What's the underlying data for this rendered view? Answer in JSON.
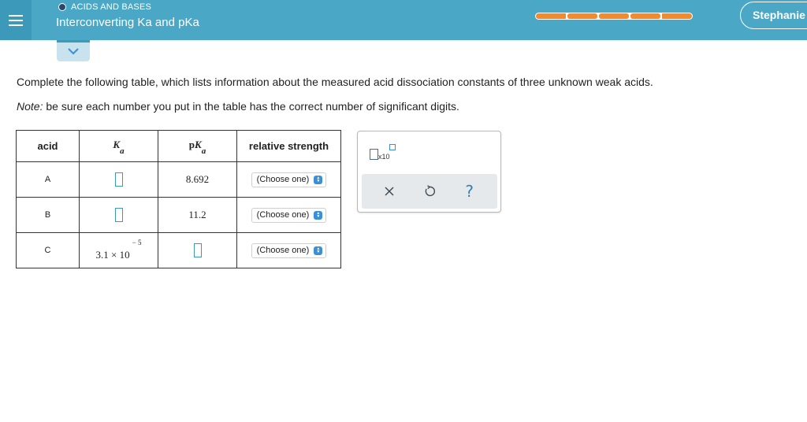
{
  "header": {
    "topic": "ACIDS AND BASES",
    "title": "Interconverting Ka and pKa",
    "user_name": "Stephanie",
    "progress_segments": 5,
    "progress_filled": 5,
    "colors": {
      "bar": "#4aa7c6",
      "progress": "#f28b2d",
      "topic_dot": "#27476e"
    }
  },
  "icons": {
    "menu": "hamburger-icon",
    "collapse": "chevron-down-icon",
    "clear": "close-icon",
    "undo": "undo-icon",
    "help": "help-icon",
    "sci_notation": "x10-icon",
    "dropdown": "select-arrows-icon"
  },
  "question": {
    "prompt": "Complete the following table, which lists information about the measured acid dissociation constants of three unknown weak acids.",
    "note_label": "Note:",
    "note_text": " be sure each number you put in the table has the correct number of significant digits."
  },
  "table": {
    "headers": {
      "acid": "acid",
      "ka_symbol": "K",
      "ka_sub": "a",
      "pka_prefix": "p",
      "pka_symbol": "K",
      "pka_sub": "a",
      "strength": "relative strength"
    },
    "rows": [
      {
        "acid": "A",
        "ka": "",
        "pka": "8.692",
        "strength": "(Choose one)"
      },
      {
        "acid": "B",
        "ka": "",
        "pka": "11.2",
        "strength": "(Choose one)"
      },
      {
        "acid": "C",
        "ka_mantissa": "3.1",
        "ka_times": "×",
        "ka_base": "10",
        "ka_exponent": "− 5",
        "pka": "",
        "strength": "(Choose one)"
      }
    ]
  },
  "tools": {
    "x10_label": "x10",
    "clear_glyph": "×",
    "undo_glyph": "↺",
    "help_glyph": "?"
  }
}
